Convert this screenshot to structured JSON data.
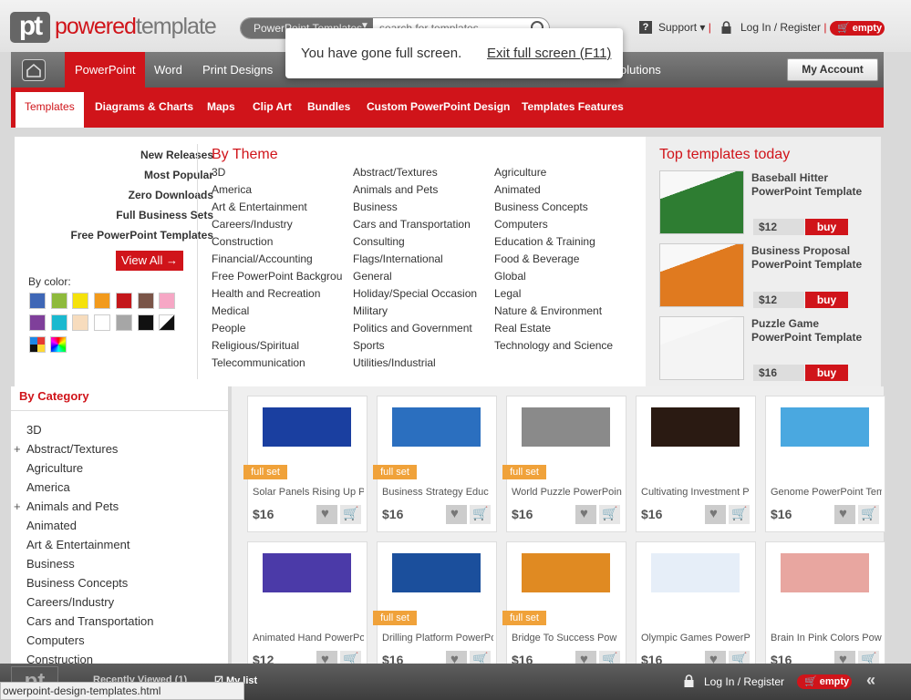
{
  "header": {
    "logo_mark": "pt",
    "logo_part1": "powered",
    "logo_part2": "template",
    "search_category": "PowerPoint Templates",
    "search_placeholder": "search for templates",
    "support": "Support",
    "login": "Log In / Register",
    "cart": "empty"
  },
  "fullscreen": {
    "message": "You have gone full screen.",
    "exit": "Exit full screen (F11)"
  },
  "nav": {
    "items": [
      "PowerPoint",
      "Word",
      "Print Designs"
    ],
    "solutions": "olutions",
    "my_account": "My Account"
  },
  "subnav": [
    "Templates",
    "Diagrams & Charts",
    "Maps",
    "Clip Art",
    "Bundles",
    "Custom PowerPoint Design",
    "Templates Features"
  ],
  "mega": {
    "releases": [
      "New Releases",
      "Most Popular",
      "Zero Downloads",
      "Full Business Sets",
      "Free PowerPoint Templates"
    ],
    "view_all": "View All →",
    "by_color": "By color:",
    "colors": [
      "#3f67b6",
      "#8eba3c",
      "#f5e20b",
      "#f29a1c",
      "#c4171b",
      "#7a5548",
      "#f6a7c5",
      "#7f3f9a",
      "#1bb9cf",
      "#f7dcbd",
      "#ffffff",
      "#a6a6a6",
      "#111111"
    ],
    "by_theme": "By Theme",
    "themes_col1": [
      "3D",
      "America",
      "Art & Entertainment",
      "Careers/Industry",
      "Construction",
      "Financial/Accounting",
      "Free PowerPoint Backgrou",
      "Health and Recreation",
      "Medical",
      "People",
      "Religious/Spiritual",
      "Telecommunication"
    ],
    "themes_col2": [
      "Abstract/Textures",
      "Animals and Pets",
      "Business",
      "Cars and Transportation",
      "Consulting",
      "Flags/International",
      "General",
      "Holiday/Special Occasion",
      "Military",
      "Politics and Government",
      "Sports",
      "Utilities/Industrial"
    ],
    "themes_col3": [
      "Agriculture",
      "Animated",
      "Business Concepts",
      "Computers",
      "Education & Training",
      "Food & Beverage",
      "Global",
      "Legal",
      "Nature & Environment",
      "Real Estate",
      "Technology and Science"
    ],
    "top_title": "Top templates today",
    "top": [
      {
        "name1": "Baseball Hitter",
        "name2": "PowerPoint Template",
        "price": "$12",
        "buy": "buy",
        "thumb": "#2e7d32"
      },
      {
        "name1": "Business Proposal",
        "name2": "PowerPoint Template",
        "price": "$12",
        "buy": "buy",
        "thumb": "#e07a1f"
      },
      {
        "name1": "Puzzle Game",
        "name2": "PowerPoint Template",
        "price": "$16",
        "buy": "buy",
        "thumb": "#f4f4f4"
      }
    ]
  },
  "sidebar": {
    "title": "By Category",
    "items": [
      "3D",
      "Abstract/Textures",
      "Agriculture",
      "America",
      "Animals and Pets",
      "Animated",
      "Art & Entertainment",
      "Business",
      "Business Concepts",
      "Careers/Industry",
      "Cars and Transportation",
      "Computers",
      "Construction"
    ]
  },
  "cards": [
    {
      "name": "Solar Panels Rising Up P",
      "price": "$16",
      "badge": "full set",
      "color": "#1a3fa0"
    },
    {
      "name": "Business Strategy Educ",
      "price": "$16",
      "badge": "full set",
      "color": "#2b6fbf"
    },
    {
      "name": "World Puzzle PowerPoin",
      "price": "$16",
      "badge": "full set",
      "color": "#8a8a8a"
    },
    {
      "name": "Cultivating Investment P",
      "price": "$16",
      "badge": "",
      "color": "#2a1a12"
    },
    {
      "name": "Genome PowerPoint Tem",
      "price": "$16",
      "badge": "",
      "color": "#4aa8e0"
    },
    {
      "name": "Animated Hand PowerPo",
      "price": "$12",
      "badge": "",
      "color": "#4b3aa8"
    },
    {
      "name": "Drilling Platform PowerPo",
      "price": "$16",
      "badge": "full set",
      "color": "#1b4f9c"
    },
    {
      "name": "Bridge To Success Pow",
      "price": "$16",
      "badge": "full set",
      "color": "#e08a22"
    },
    {
      "name": "Olympic Games PowerP",
      "price": "$16",
      "badge": "",
      "color": "#e6eef8"
    },
    {
      "name": "Brain In Pink Colors Pow",
      "price": "$16",
      "badge": "",
      "color": "#e8a6a0"
    }
  ],
  "bottom": {
    "recent": "Recently Viewed (1)",
    "mylist": "My list",
    "login": "Log In / Register",
    "cart": "empty",
    "status": "owerpoint-design-templates.html"
  }
}
